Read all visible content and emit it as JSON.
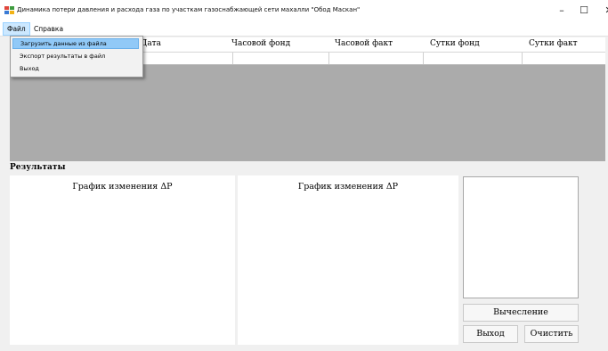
{
  "window": {
    "title": "Динамика потери давления и расхода газа по участкам газоснабжающей сети махалли \"Обод Маскан\"",
    "minimize_glyph": "–",
    "maximize_glyph": "☐",
    "close_glyph": "✕"
  },
  "menu": {
    "file": "Файл",
    "help": "Справка",
    "file_items": [
      "Загрузить данные из файла",
      "Экспорт результаты в файл",
      "Выход"
    ]
  },
  "table": {
    "columns": [
      "Дата",
      "Часовой фонд",
      "Часовой факт",
      "Сутки фонд",
      "Сутки факт"
    ]
  },
  "results": {
    "label": "Результаты",
    "chart1_title": "График изменения ΔP",
    "chart2_title": "График изменения ΔP"
  },
  "buttons": {
    "compute": "Вычесление",
    "exit": "Выход",
    "clear": "Очистить"
  },
  "colors": {
    "grid_background": "#ababab",
    "menu_highlight": "#91c9f7"
  }
}
